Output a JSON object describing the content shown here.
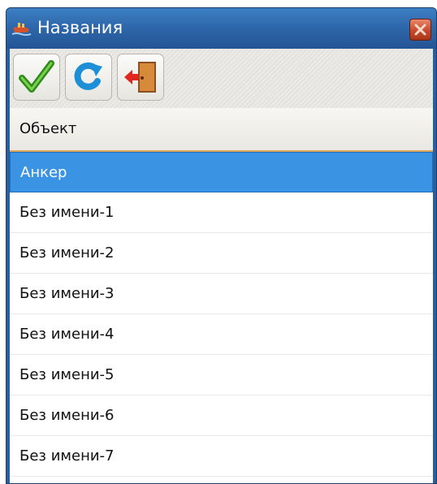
{
  "window": {
    "title": "Названия",
    "app_icon": "ship-icon",
    "close_icon": "close-icon"
  },
  "toolbar": {
    "buttons": [
      {
        "icon": "checkmark-icon",
        "action": "ok"
      },
      {
        "icon": "refresh-icon",
        "action": "refresh"
      },
      {
        "icon": "exit-door-icon",
        "action": "exit"
      }
    ]
  },
  "table": {
    "header": "Объект",
    "selected_index": 0,
    "rows": [
      "Анкер",
      "Без имени-1",
      "Без имени-2",
      "Без имени-3",
      "Без имени-4",
      "Без имени-5",
      "Без имени-6",
      "Без имени-7"
    ]
  },
  "colors": {
    "titlebar": "#2d66a9",
    "selection": "#3b93e3",
    "header_underline": "#e2a35a"
  }
}
